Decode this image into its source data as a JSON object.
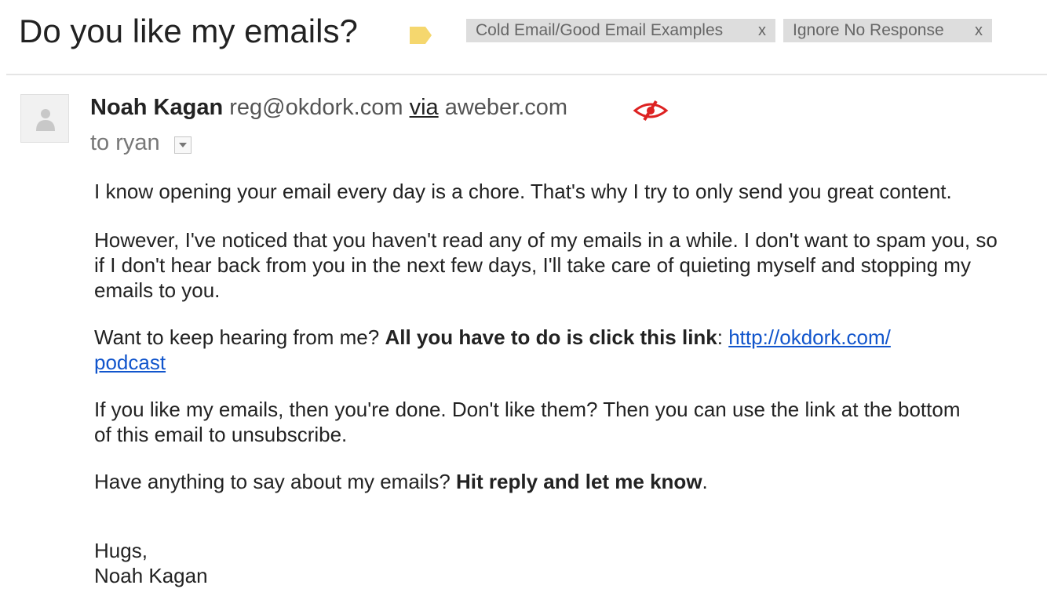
{
  "thread": {
    "subject": "Do you like my emails?",
    "labels": [
      {
        "name": "Cold Email/Good Email Examples",
        "remove": "x"
      },
      {
        "name": "Ignore No Response",
        "remove": "x"
      }
    ],
    "colors": {
      "label_tag": "#f5d76e",
      "chip_bg": "#dddddd",
      "link": "#1155cc",
      "auth_icon": "#dd2222"
    }
  },
  "message": {
    "sender_name": "Noah Kagan",
    "sender_email": "reg@okdork.com",
    "via_label": "via",
    "via_domain": "aweber.com",
    "to_line": "to ryan",
    "icons": {
      "avatar": "person-icon",
      "auth": "unauthenticated-sender-icon",
      "details": "chevron-down-icon"
    },
    "body": {
      "p1": "I know opening your email every day is a chore. That's why I try to only send you great content.",
      "p2": "However, I've noticed that you haven't read any of my emails in a while. I don't want to spam you, so if I don't hear back from you in the next few days, I'll take care of quieting myself and stopping my emails to you.",
      "p3_lead": "Want to keep hearing from me? ",
      "p3_bold": "All you have to do is click this link",
      "p3_colon": ": ",
      "p3_link": "http://okdork.com/podcast",
      "p4": "If you like my emails, then you're done. Don't like them? Then you can use the link at the bottom of this email to unsubscribe.",
      "p5_lead": "Have anything to say about my emails? ",
      "p5_bold": "Hit reply and let me know",
      "p5_end": ".",
      "signoff": "Hugs,",
      "signature": "Noah Kagan"
    }
  }
}
